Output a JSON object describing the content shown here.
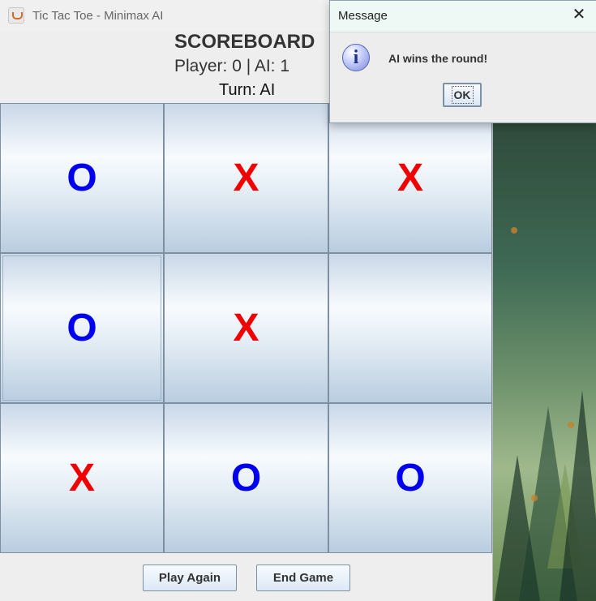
{
  "window": {
    "title": "Tic Tac Toe - Minimax AI"
  },
  "scoreboard": {
    "title": "SCOREBOARD",
    "score_text": "Player: 0   |   AI: 1",
    "turn_text": "Turn: AI"
  },
  "board": {
    "cells": [
      "O",
      "X",
      "X",
      "O",
      "X",
      "",
      "X",
      "O",
      "O"
    ]
  },
  "controls": {
    "play_again_label": "Play Again",
    "end_game_label": "End Game"
  },
  "dialog": {
    "title": "Message",
    "message": "AI wins the round!",
    "ok_label": "OK",
    "icon": "info-icon"
  },
  "colors": {
    "o_mark": "#0000f0",
    "x_mark": "#f10000",
    "accent": "#7d91a6"
  }
}
